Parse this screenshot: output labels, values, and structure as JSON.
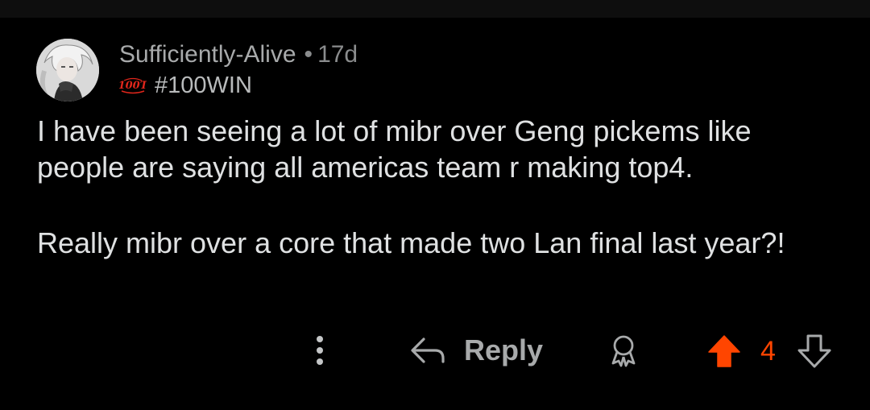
{
  "comment": {
    "author": "Sufficiently-Alive",
    "separator": "•",
    "age": "17d",
    "flair_text": "#100WIN",
    "flair_logo_text": "100T",
    "avatar_icon": "anime-avatar",
    "paragraphs": [
      "I have been seeing a lot of mibr over Geng pickems like people are saying all americas team r making top4.",
      "Really mibr over a core that made two Lan final last year?!"
    ]
  },
  "actions": {
    "more_icon": "vertical-ellipsis-icon",
    "reply_icon": "reply-arrow-icon",
    "reply_label": "Reply",
    "award_icon": "award-icon",
    "upvote_icon": "upvote-arrow-icon",
    "score": "4",
    "downvote_icon": "downvote-arrow-icon"
  },
  "colors": {
    "background": "#000000",
    "upvoted": "#ff4500",
    "muted_text": "#a8aaab",
    "body_text": "#dfe1e2",
    "flair_logo": "#e0261b"
  }
}
